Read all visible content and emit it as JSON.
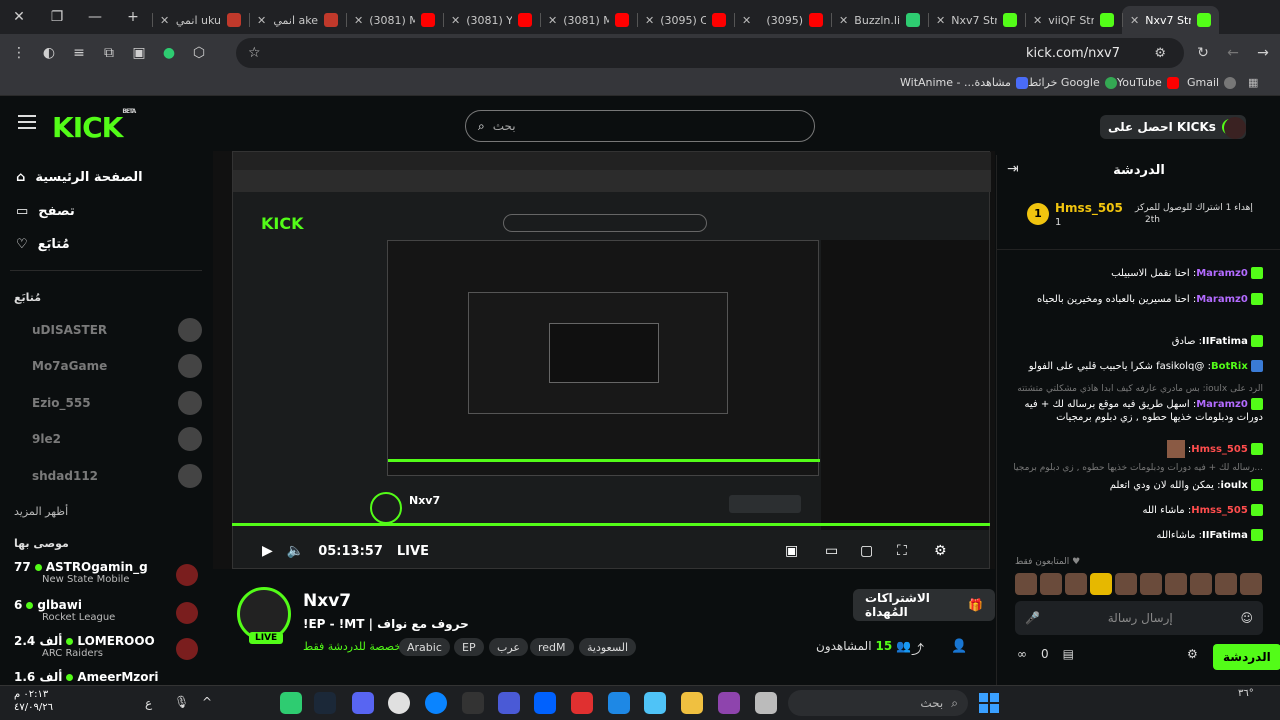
{
  "browser": {
    "tabs": [
      {
        "label": "انمي uku",
        "fav": "#c0392b"
      },
      {
        "label": "انمي ake",
        "fav": "#c0392b"
      },
      {
        "label": "(3081) M",
        "fav": "#ff0000"
      },
      {
        "label": "(3081) Y",
        "fav": "#ff0000"
      },
      {
        "label": "(3081) M",
        "fav": "#ff0000"
      },
      {
        "label": "(3095) C",
        "fav": "#ff0000"
      },
      {
        "label": "(3095)",
        "fav": "#ff0000"
      },
      {
        "label": "Buzzln.li",
        "fav": "#2ecc71"
      },
      {
        "label": "Nxv7 Str",
        "fav": "#53fc18"
      },
      {
        "label": "viiQF Str",
        "fav": "#53fc18"
      },
      {
        "label": "Nxv7 Str",
        "fav": "#53fc18",
        "active": true
      }
    ],
    "url": "kick.com/nxv7",
    "bookmarks": [
      "WitAnime - ...مشاهدة",
      "خرائط Google",
      "YouTube",
      "Gmail"
    ]
  },
  "header": {
    "logo": "KICK",
    "logo_beta": "BETA",
    "search_placeholder": "بحث",
    "get_kicks": "احصل على KICKs"
  },
  "sidebar": {
    "nav": [
      "الصفحة الرئيسية",
      "تصفح",
      "مُتابَع"
    ],
    "following_title": "مُتابَع",
    "following": [
      "uDISASTER",
      "Mo7aGame",
      "Ezio_555",
      "9le2",
      "shdad112"
    ],
    "show_more": "أظهر المزيد",
    "recommended_title": "موصى بها",
    "recommended": [
      {
        "count": "77",
        "name": "ASTROgamin_g",
        "game": "New State Mobile"
      },
      {
        "count": "6",
        "name": "glbawi",
        "game": "Rocket League"
      },
      {
        "count": "2.4 ألف",
        "name": "LOMEROOO",
        "game": "ARC Raiders"
      },
      {
        "count": "1.6 ألف",
        "name": "AmeerMzori",
        "game": ""
      }
    ]
  },
  "player": {
    "timecode": "05:13:57",
    "live": "LIVE"
  },
  "stream": {
    "name": "Nxv7",
    "title": "!EP - !MT | حروف مع نواف",
    "category": "مخصصة للدردشة فقط",
    "tags": [
      "Arabic",
      "EP",
      "عرب",
      "redM",
      "السعودية"
    ],
    "live_badge": "LIVE",
    "gift_button": "الاشتراكات المُهداة",
    "viewers_label": "المشاهدون",
    "viewers": "15"
  },
  "chat": {
    "title": "الدردشة",
    "pinned_user": "Hmss_505",
    "pinned_count": "1",
    "pinned_text": "إهداء 1 اشتراك للوصول للمركز",
    "pinned_rank": "2th",
    "messages": [
      {
        "user": "Maramz0",
        "color": "#b36bff",
        "text": "احنا نقمل الاسبيلب"
      },
      {
        "user": "Maramz0",
        "color": "#b36bff",
        "text": "احنا مسيرين بالعباده ومخيرين بالحياه"
      },
      {
        "user": "IIFatima",
        "color": "#ffffff",
        "text": "صادق"
      },
      {
        "user": "BotRix",
        "color": "#53fc18",
        "text": "@fasikolq شكرا ياحبيب قلبي على الفولو"
      },
      {
        "user": "Maramz0",
        "color": "#b36bff",
        "text": "اسهل طريق فيه موقع برساله لك + فيه دورات ودبلومات خذيها حطوه , زي دبلوم برمجيات"
      },
      {
        "user": "Hmss_505",
        "color": "#ff4d4d",
        "text": ""
      },
      {
        "user": "ioulx",
        "color": "#ffffff",
        "text": "يمكن والله لان ودي اتعلم"
      },
      {
        "user": "Hmss_505",
        "color": "#ff4d4d",
        "text": "ماشاء الله"
      },
      {
        "user": "IIFatima",
        "color": "#ffffff",
        "text": "ماشاءالله"
      }
    ],
    "replies": [
      "الرد على ioulx: بس مادري عارفه كيف ابدا هاذي مشكلتي متشتته",
      "...رساله لك + فيه دورات ودبلومات خذيها حطوه , زي دبلوم برمجيات"
    ],
    "followers_only": "المتابعون فقط",
    "input_placeholder": "إرسال رسالة",
    "send_button": "الدردشة",
    "points": "0"
  },
  "taskbar": {
    "time": "٠٢:١٣ م",
    "date": "٤٧/٠٩/٢٦",
    "lang": "ع",
    "search": "بحث",
    "temp": "٣٦°"
  }
}
